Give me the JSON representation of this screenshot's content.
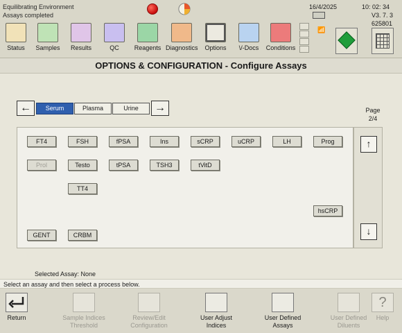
{
  "status": {
    "line1": "Equilibrating Environment",
    "line2": "Assays completed",
    "date": "16/4/2025",
    "time": "10: 02: 34",
    "version": "V3. 7. 3",
    "serial": "625801"
  },
  "nav": [
    {
      "label": "Status",
      "icon": "status-icon",
      "color": "#e0a040"
    },
    {
      "label": "Samples",
      "icon": "samples-icon",
      "color": "#4caf50"
    },
    {
      "label": "Results",
      "icon": "results-icon",
      "color": "#b070c0"
    },
    {
      "label": "QC",
      "icon": "qc-icon",
      "color": "#8a70d8"
    },
    {
      "label": "Reagents",
      "icon": "reagents-icon",
      "color": "#2e9a40"
    },
    {
      "label": "Diagnostics",
      "icon": "diagnostics-icon",
      "color": "#d26a2a"
    },
    {
      "label": "Options",
      "icon": "options-icon",
      "color": "#d8d6ca"
    },
    {
      "label": "\\/-Docs",
      "icon": "vdocs-icon",
      "color": "#3a78c8"
    },
    {
      "label": "Conditions",
      "icon": "conditions-icon",
      "color": "#d62828"
    }
  ],
  "title": "OPTIONS & CONFIGURATION - Configure Assays",
  "tabs": [
    {
      "label": "Serum",
      "selected": true
    },
    {
      "label": "Plasma",
      "selected": false
    },
    {
      "label": "Urine",
      "selected": false
    }
  ],
  "page": {
    "label": "Page",
    "value": "2/4"
  },
  "assays": {
    "ft4": "FT4",
    "fsh": "FSH",
    "fpsa": "fPSA",
    "ins": "Ins",
    "scrp": "sCRP",
    "ucrp": "uCRP",
    "lh": "LH",
    "prog": "Prog",
    "prol": "Prol",
    "testo": "Testo",
    "tpsa": "tPSA",
    "tsh3": "TSH3",
    "tvitd": "tVitD",
    "tt4": "TT4",
    "hscrp": "hsCRP",
    "gent": "GENT",
    "crbm": "CRBM"
  },
  "selected_assay": "Selected Assay: None",
  "info": "Select an assay and then select a process below.",
  "bottom": {
    "return": "Return",
    "sample_indices_1": "Sample Indices",
    "sample_indices_2": "Threshold",
    "review_1": "Review/Edit",
    "review_2": "Configuration",
    "user_adjust_1": "User Adjust",
    "user_adjust_2": "Indices",
    "user_defined_assays_1": "User Defined",
    "user_defined_assays_2": "Assays",
    "user_defined_diluents_1": "User Defined",
    "user_defined_diluents_2": "Diluents",
    "help": "Help"
  },
  "colors": {
    "selected_tab": "#2f5fae",
    "green": "#1f9d3a",
    "alert": "#c80d0d"
  }
}
